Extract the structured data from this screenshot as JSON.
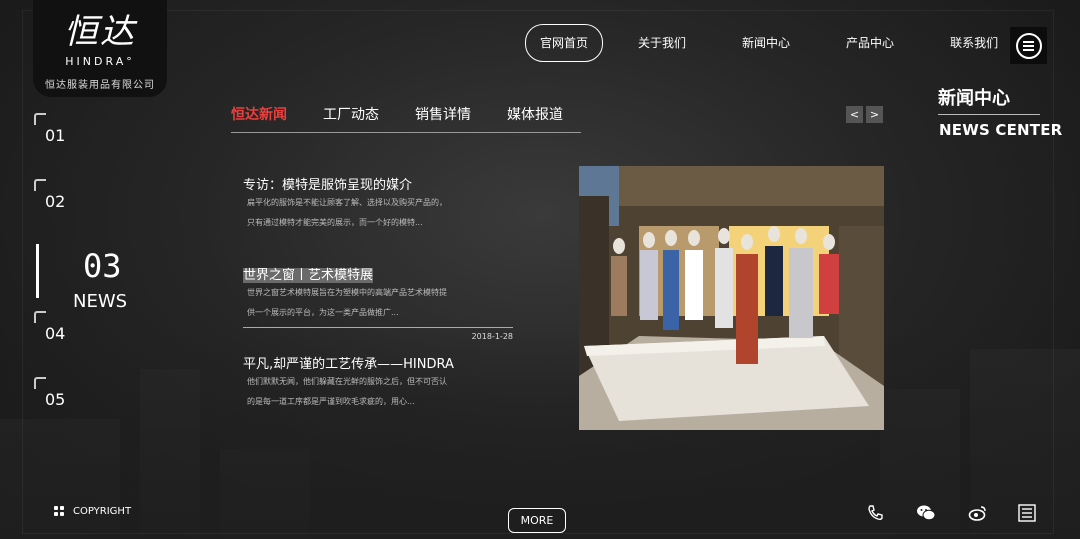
{
  "logo": {
    "mark": "恒达",
    "en": "HINDRA°",
    "cn": "恒达服装用品有限公司"
  },
  "nav": [
    {
      "label": "官网首页",
      "active": true
    },
    {
      "label": "关于我们",
      "active": false
    },
    {
      "label": "新闻中心",
      "active": false
    },
    {
      "label": "产品中心",
      "active": false
    },
    {
      "label": "联系我们",
      "active": false
    }
  ],
  "side_index": [
    "01",
    "02",
    "04",
    "05"
  ],
  "current": {
    "num": "03",
    "label": "NEWS"
  },
  "tabs": [
    {
      "label": "恒达新闻",
      "active": true
    },
    {
      "label": "工厂动态",
      "active": false
    },
    {
      "label": "销售详情",
      "active": false
    },
    {
      "label": "媒体报道",
      "active": false
    }
  ],
  "arrows": {
    "prev": "<",
    "next": ">"
  },
  "news_center": {
    "cn": "新闻中心",
    "en": "NEWS CENTER"
  },
  "articles": [
    {
      "title": "专访：模特是服饰呈现的媒介",
      "lines": [
        "扁平化的服饰是不能让顾客了解、选择以及购买产品的，",
        "只有通过模特才能完美的展示，而一个好的模特..."
      ],
      "date": ""
    },
    {
      "title": "世界之窗丨艺术模特展",
      "lines": [
        "世界之窗艺术模特展旨在为塑模中的高端产品艺术模特提",
        "供一个展示的平台，为这一类产品做推广..."
      ],
      "date": "2018-1-28"
    },
    {
      "title": "平凡,却严谨的工艺传承——HINDRA",
      "lines": [
        "他们默默无闻，他们躲藏在光鲜的服饰之后，但不可否认",
        "的是每一道工序都是严谨到吹毛求疵的，用心..."
      ],
      "date": ""
    }
  ],
  "footer": {
    "copyright": "COPYRIGHT",
    "more": "MORE"
  },
  "icons": [
    "phone-icon",
    "wechat-icon",
    "weibo-icon",
    "list-icon"
  ]
}
